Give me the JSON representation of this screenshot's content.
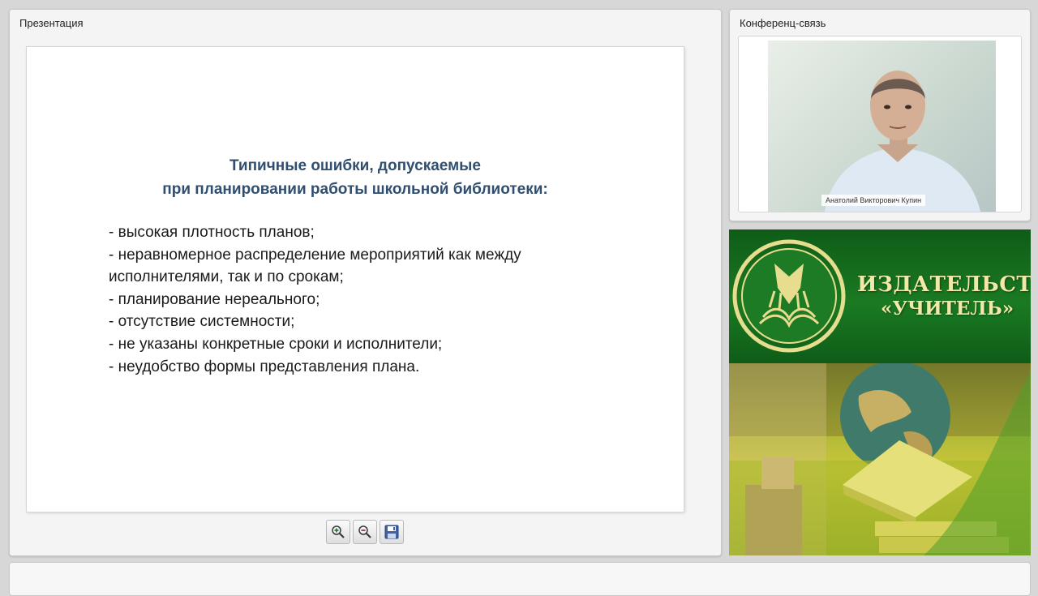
{
  "presentation": {
    "panel_title": "Презентация",
    "slide": {
      "title_line1": "Типичные ошибки, допускаемые",
      "title_line2": "при планировании работы школьной библиотеки:",
      "items": [
        "- высокая плотность планов;",
        "- неравномерное распределение мероприятий как между исполнителями, так и по срокам;",
        "- планирование нереального;",
        "- отсутствие системности;",
        "- не указаны конкретные сроки и исполнители;",
        "- неудобство формы представления плана."
      ]
    },
    "toolbar": {
      "zoom_in_icon": "zoom-in-icon",
      "zoom_out_icon": "zoom-out-icon",
      "save_icon": "floppy-disk-icon"
    }
  },
  "conference": {
    "panel_title": "Конференц-связь",
    "participant_name": "Анатолий Викторович Купин"
  },
  "publisher": {
    "line1": "ИЗДАТЕЛЬСТВО",
    "line2": "«УЧИТЕЛЬ»"
  },
  "colors": {
    "slide_title": "#2f4e70",
    "publisher_green": "#1a7a22",
    "publisher_text": "#f2e9a8"
  }
}
